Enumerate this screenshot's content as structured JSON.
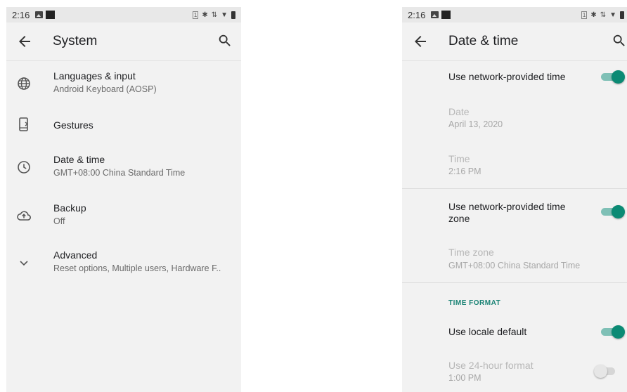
{
  "left_screen": {
    "status_bar": {
      "time": "2:16",
      "sim_label": "1"
    },
    "app_bar": {
      "title": "System",
      "back_icon": "arrow-back-icon",
      "search_icon": "search-icon"
    },
    "items": [
      {
        "title": "Languages & input",
        "subtitle": "Android Keyboard (AOSP)",
        "icon": "globe-icon"
      },
      {
        "title": "Gestures",
        "subtitle": "",
        "icon": "phone-gesture-icon"
      },
      {
        "title": "Date & time",
        "subtitle": "GMT+08:00 China Standard Time",
        "icon": "clock-icon"
      },
      {
        "title": "Backup",
        "subtitle": "Off",
        "icon": "cloud-upload-icon"
      },
      {
        "title": "Advanced",
        "subtitle": "Reset options, Multiple users, Hardware F..",
        "icon": "chevron-down-icon"
      }
    ]
  },
  "right_screen": {
    "status_bar": {
      "time": "2:16",
      "sim_label": "1"
    },
    "app_bar": {
      "title": "Date & time",
      "back_icon": "arrow-back-icon",
      "search_icon": "search-icon"
    },
    "network_time": {
      "title": "Use network-provided time",
      "enabled": true
    },
    "date": {
      "title": "Date",
      "value": "April 13, 2020"
    },
    "time": {
      "title": "Time",
      "value": "2:16 PM"
    },
    "network_time_zone": {
      "title_line1": "Use network-provided time",
      "title_line2": "zone",
      "enabled": true
    },
    "time_zone": {
      "title": "Time zone",
      "value": "GMT+08:00 China Standard Time"
    },
    "time_format_header": "TIME FORMAT",
    "locale_default": {
      "title": "Use locale default",
      "enabled": true
    },
    "hour24": {
      "title": "Use 24-hour format",
      "value": "1:00 PM",
      "enabled": false
    }
  },
  "colors": {
    "accent": "#0b8a74",
    "accent_track": "#7fc0b6",
    "background": "#f2f2f2",
    "status_bar": "#e8e8e8"
  }
}
